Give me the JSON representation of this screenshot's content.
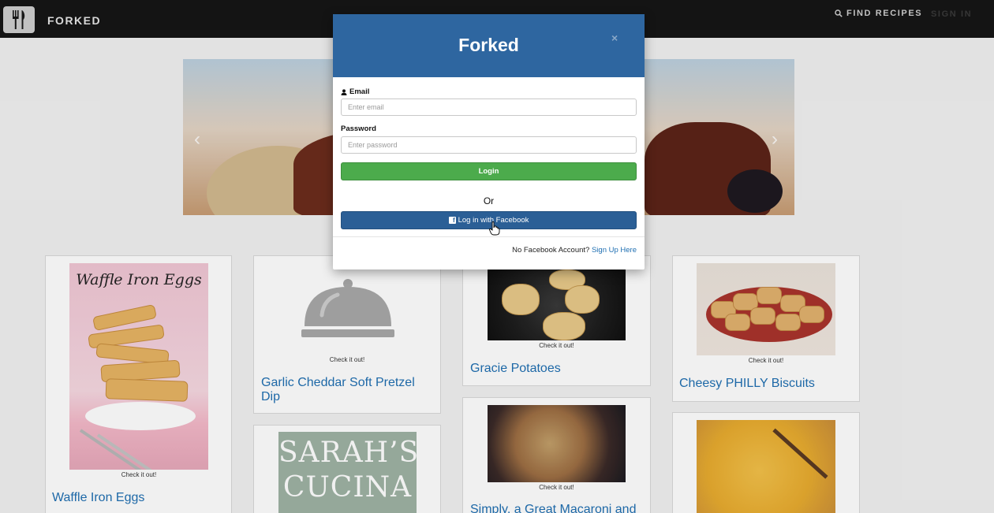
{
  "navbar": {
    "brand": "FORKED",
    "find_recipes": "FIND RECIPES",
    "sign_in": "SIGN IN"
  },
  "carousel": {
    "prev_icon": "chevron-left-icon",
    "next_icon": "chevron-right-icon"
  },
  "recipes": [
    {
      "title": "Waffle Iron Eggs",
      "image_caption": "Waffle Iron Eggs",
      "cta": "Check it out!"
    },
    {
      "title": "Garlic Cheddar Soft Pretzel Dip",
      "cta": "Check it out!"
    },
    {
      "title": "Gracie Potatoes",
      "cta": "Check it out!"
    },
    {
      "title": "Cheesy PHILLY Biscuits",
      "cta": "Check it out!"
    },
    {
      "title": "",
      "image_caption_line1": "SARAH’S",
      "image_caption_line2": "CUCINA"
    },
    {
      "title": "Simply, a Great Macaroni and",
      "cta": "Check it out!"
    },
    {
      "title": ""
    }
  ],
  "modal": {
    "title": "Forked",
    "close": "×",
    "email_label": "Email",
    "email_placeholder": "Enter email",
    "password_label": "Password",
    "password_placeholder": "Enter password",
    "login_button": "Login",
    "or_text": "Or",
    "facebook_button": "Log in with Facebook",
    "footer_prefix": "No Facebook Account?",
    "footer_link": "Sign Up Here"
  },
  "colors": {
    "header_blue": "#2e66a0",
    "login_green": "#4cab4c",
    "facebook_blue": "#2b5f96",
    "link_blue": "#1f6fb2"
  }
}
